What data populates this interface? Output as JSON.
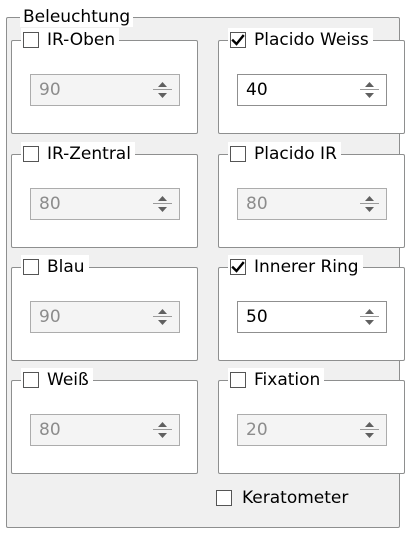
{
  "panel": {
    "title": "Beleuchtung"
  },
  "groups": [
    {
      "label": "IR-Oben",
      "checked": false,
      "value": "90"
    },
    {
      "label": "Placido Weiss",
      "checked": true,
      "value": "40"
    },
    {
      "label": "IR-Zentral",
      "checked": false,
      "value": "80"
    },
    {
      "label": "Placido IR",
      "checked": false,
      "value": "80"
    },
    {
      "label": "Blau",
      "checked": false,
      "value": "90"
    },
    {
      "label": "Innerer Ring",
      "checked": true,
      "value": "50"
    },
    {
      "label": "Weiß",
      "checked": false,
      "value": "80"
    },
    {
      "label": "Fixation",
      "checked": false,
      "value": "20"
    }
  ],
  "keratometer": {
    "label": "Keratometer",
    "checked": false
  }
}
